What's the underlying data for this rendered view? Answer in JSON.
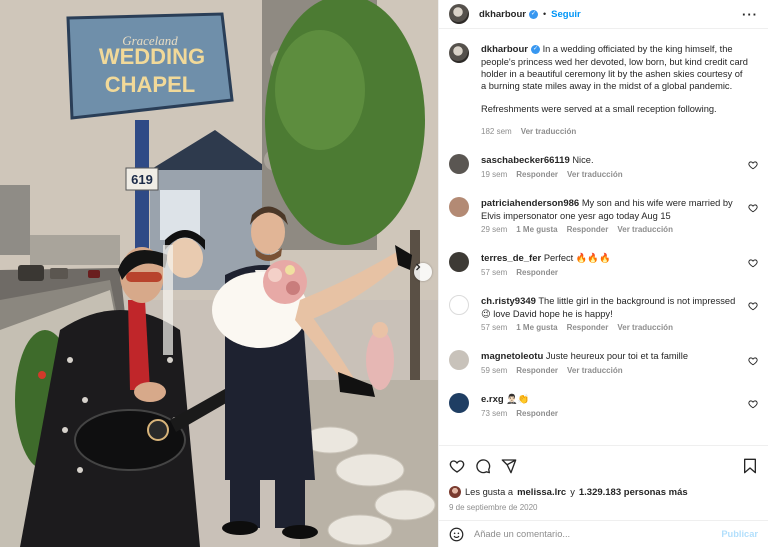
{
  "post": {
    "username": "dkharbour",
    "follow_label": "Seguir",
    "separator": "•",
    "more_label": "···",
    "next_label": "›"
  },
  "caption": {
    "username": "dkharbour",
    "text1": "In a wedding officiated by the king himself, the people's princess wed her devoted, low born, but kind credit card holder in a beautiful ceremony lit by the ashen skies courtesy of a burning state miles away in the midst of a global pandemic.",
    "text2": "Refreshments were served at a small reception following.",
    "time": "182 sem",
    "translate": "Ver traducción"
  },
  "photo": {
    "sign_top": "Graceland",
    "sign_main1": "WEDDING",
    "sign_main2": "CHAPEL",
    "sign_number": "619"
  },
  "comments": [
    {
      "username": "saschabecker66119",
      "text": "Nice.",
      "time": "19 sem",
      "likes": "",
      "reply": "Responder",
      "translate": "Ver traducción",
      "avatar_color": "#5a5652"
    },
    {
      "username": "patriciahenderson986",
      "text": "My son and his wife were married by Elvis impersonator one yesr ago today Aug 15",
      "time": "29 sem",
      "likes": "1 Me gusta",
      "reply": "Responder",
      "translate": "Ver traducción",
      "avatar_color": "#b38a74"
    },
    {
      "username": "terres_de_fer",
      "text": "Perfect 🔥🔥🔥",
      "time": "57 sem",
      "likes": "",
      "reply": "Responder",
      "translate": "",
      "avatar_color": "#3d3a35"
    },
    {
      "username": "ch.risty9349",
      "text": "The little girl in the background is not impressed 😉 love David hope he is happy!",
      "time": "57 sem",
      "likes": "1 Me gusta",
      "reply": "Responder",
      "translate": "Ver traducción",
      "avatar_color": "#ffffff"
    },
    {
      "username": "magnetoleotu",
      "text": "Juste heureux pour toi et ta famille",
      "time": "59 sem",
      "likes": "",
      "reply": "Responder",
      "translate": "Ver traducción",
      "avatar_color": "#c8c2ba"
    },
    {
      "username": "e.rxg",
      "text": "🤵🏻‍♂️👏",
      "time": "73 sem",
      "likes": "",
      "reply": "Responder",
      "translate": "",
      "avatar_color": "#1f3e63"
    }
  ],
  "likes": {
    "prefix": "Les gusta a ",
    "user": "melissa.lrc",
    "middle": " y ",
    "count": "1.329.183 personas más"
  },
  "date": "9 de septiembre de 2020",
  "add_comment": {
    "placeholder": "Añade un comentario...",
    "publish": "Publicar"
  },
  "colors": {
    "link_blue": "#0095f6",
    "verified_blue": "#3897f0",
    "muted": "#8e8e8e",
    "publish_disabled": "#b2dffc"
  }
}
